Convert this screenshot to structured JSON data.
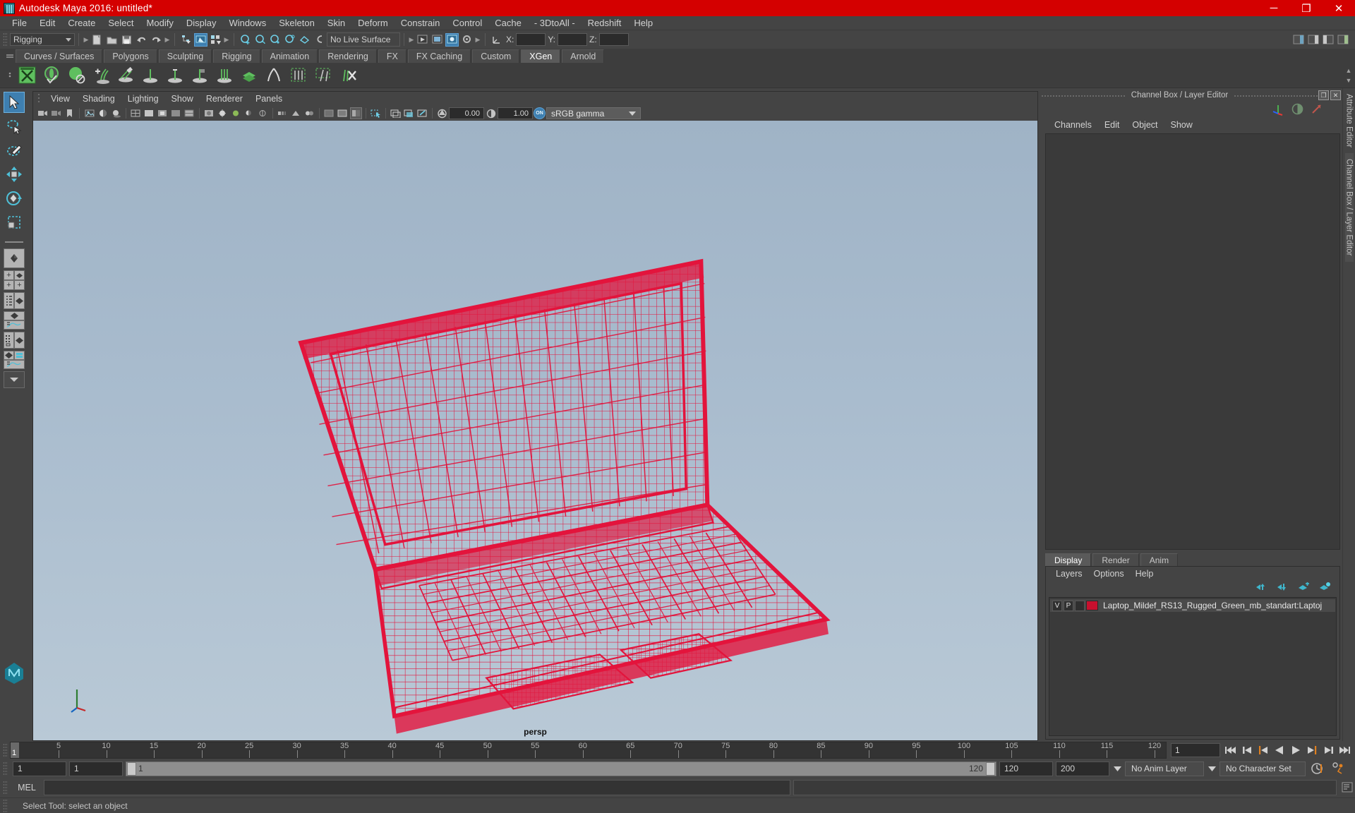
{
  "window": {
    "title": "Autodesk Maya 2016: untitled*",
    "icon": "maya-icon",
    "buttons": {
      "minimize": "─",
      "maximize": "❐",
      "close": "✕"
    },
    "titlebar_color": "#d40000"
  },
  "menubar": {
    "items": [
      "File",
      "Edit",
      "Create",
      "Select",
      "Modify",
      "Display",
      "Windows",
      "Skeleton",
      "Skin",
      "Deform",
      "Constrain",
      "Control",
      "Cache",
      "- 3DtoAll -",
      "Redshift",
      "Help"
    ]
  },
  "statusbar": {
    "menuset": "Rigging",
    "live_surface": "No Live Surface",
    "axis": {
      "x_label": "X:",
      "y_label": "Y:",
      "z_label": "Z:",
      "x_value": "",
      "y_value": "",
      "z_value": ""
    }
  },
  "shelf": {
    "tabs": [
      "Curves / Surfaces",
      "Polygons",
      "Sculpting",
      "Rigging",
      "Animation",
      "Rendering",
      "FX",
      "FX Caching",
      "Custom",
      "XGen",
      "Arnold"
    ],
    "selected_tab": "XGen",
    "icons": [
      "xgen-editor-icon",
      "xgen-preview-icon",
      "xgen-sphere-icon",
      "xgen-add-description-icon",
      "xgen-groom-icon",
      "xgen-density-icon",
      "xgen-length-icon",
      "xgen-width-icon",
      "xgen-clump-icon",
      "xgen-noise-icon",
      "xgen-cut-icon",
      "xgen-collection-icon",
      "xgen-guides-icon",
      "xgen-mask-icon",
      "xgen-region-icon",
      "xgen-delete-icon"
    ]
  },
  "toolbox": {
    "tools": [
      {
        "name": "select-tool",
        "selected": true
      },
      {
        "name": "lasso-select-tool",
        "selected": false
      },
      {
        "name": "paint-select-tool",
        "selected": false
      },
      {
        "name": "move-tool",
        "selected": false
      },
      {
        "name": "rotate-tool",
        "selected": false
      },
      {
        "name": "scale-tool",
        "selected": false
      }
    ],
    "layouts": [
      "single-perspective-layout",
      "four-view-layout",
      "outliner-persp-layout",
      "hypergraph-persp-layout",
      "persp-graph-layout",
      "outliner-graph-layout",
      "hypershade-persp-layout",
      "more-layouts"
    ]
  },
  "viewport": {
    "menus": [
      "View",
      "Shading",
      "Lighting",
      "Show",
      "Renderer",
      "Panels"
    ],
    "toolbar": {
      "exposure": "0.00",
      "gamma": "1.00",
      "color_management": "sRGB gamma",
      "cm_toggle": "ON"
    },
    "camera_label": "persp",
    "background_top": "#9fb3c6",
    "background_bottom": "#b9c9d6",
    "model": {
      "name": "Laptop_Mildef_RS13_Rugged_Green wireframe",
      "wireframe_color": "#e3143c"
    },
    "axis_gizmo": {
      "x": "X",
      "y": "Y",
      "z": "Z"
    }
  },
  "right_panel": {
    "title": "Channel Box / Layer Editor",
    "window_buttons": [
      "undock-icon",
      "close-icon"
    ],
    "header_icons": [
      "move-axis-icon",
      "half-circle-icon",
      "diagonal-arrow-icon"
    ],
    "channel_menus": [
      "Channels",
      "Edit",
      "Object",
      "Show"
    ],
    "layer_editor": {
      "tabs": [
        "Display",
        "Render",
        "Anim"
      ],
      "selected_tab": "Display",
      "menus": [
        "Layers",
        "Options",
        "Help"
      ],
      "buttons": [
        "move-layer-up-icon",
        "move-layer-down-icon",
        "new-layer-icon",
        "new-layer-from-selected-icon"
      ],
      "layers": [
        {
          "visibility": "V",
          "playback": "P",
          "state": "",
          "color": "#c8102e",
          "name": "Laptop_Mildef_RS13_Rugged_Green_mb_standart:Laptoj"
        }
      ]
    },
    "side_tabs": [
      "Attribute Editor",
      "Channel Box / Layer Editor"
    ]
  },
  "timeline": {
    "current_frame": "1",
    "ticks": [
      5,
      10,
      15,
      20,
      25,
      30,
      35,
      40,
      45,
      50,
      55,
      60,
      65,
      70,
      75,
      80,
      85,
      90,
      95,
      100,
      105,
      110,
      115,
      120
    ],
    "start": 1,
    "end": 120,
    "frame_field": "1",
    "playback_buttons": [
      "go-to-start-icon",
      "step-back-keyframe-icon",
      "step-back-frame-icon",
      "play-backwards-icon",
      "play-forwards-icon",
      "step-forward-frame-icon",
      "step-forward-keyframe-icon",
      "go-to-end-icon"
    ]
  },
  "range": {
    "anim_start": "1",
    "range_start": "1",
    "slider_min": "1",
    "slider_max": "120",
    "range_end": "120",
    "anim_end": "200",
    "anim_layer": "No Anim Layer",
    "character_set": "No Character Set",
    "buttons": [
      "auto-keyframe-icon",
      "animation-preferences-icon"
    ]
  },
  "command_line": {
    "language": "MEL",
    "input": "",
    "output": ""
  },
  "help_line": {
    "text": "Select Tool: select an object"
  }
}
